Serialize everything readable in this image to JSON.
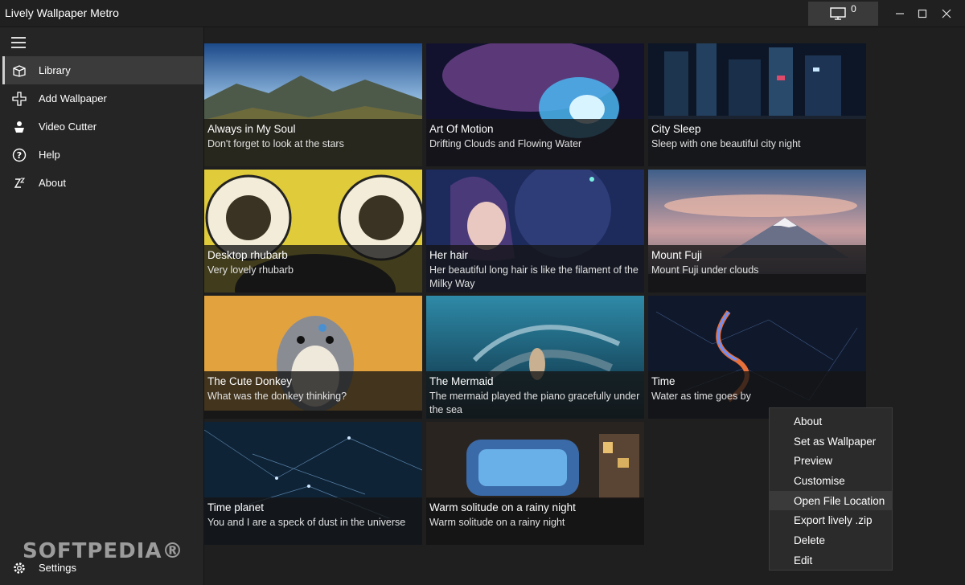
{
  "app": {
    "title": "Lively Wallpaper Metro",
    "monitor_count": "0"
  },
  "sidebar": {
    "items": [
      {
        "label": "Library",
        "icon": "library-icon"
      },
      {
        "label": "Add Wallpaper",
        "icon": "plus-icon"
      },
      {
        "label": "Video Cutter",
        "icon": "video-cutter-icon"
      },
      {
        "label": "Help",
        "icon": "help-icon"
      },
      {
        "label": "About",
        "icon": "about-icon"
      }
    ],
    "settings_label": "Settings",
    "watermark": "SOFTPEDIA®"
  },
  "library": {
    "tiles": [
      {
        "title": "Always in My Soul",
        "desc": "Don't forget to look at the stars"
      },
      {
        "title": "Art Of Motion",
        "desc": "Drifting Clouds and Flowing Water"
      },
      {
        "title": "City Sleep",
        "desc": "Sleep with one beautiful city night"
      },
      {
        "title": "Desktop rhubarb",
        "desc": "Very lovely rhubarb"
      },
      {
        "title": "Her hair",
        "desc": "Her beautiful long hair is like the filament of the Milky Way"
      },
      {
        "title": "Mount Fuji",
        "desc": "Mount Fuji under clouds"
      },
      {
        "title": "The Cute Donkey",
        "desc": "What was the donkey thinking?"
      },
      {
        "title": "The Mermaid",
        "desc": "The mermaid played the piano gracefully under the sea"
      },
      {
        "title": "Time",
        "desc": "Water as time goes by"
      },
      {
        "title": "Time planet",
        "desc": "You and I are a speck of dust in the universe"
      },
      {
        "title": "Warm solitude on a rainy night",
        "desc": "Warm solitude on a rainy night"
      }
    ]
  },
  "context_menu": {
    "items": [
      "About",
      "Set as Wallpaper",
      "Preview",
      "Customise",
      "Open File Location",
      "Export lively .zip",
      "Delete",
      "Edit"
    ],
    "highlighted": "Open File Location"
  }
}
